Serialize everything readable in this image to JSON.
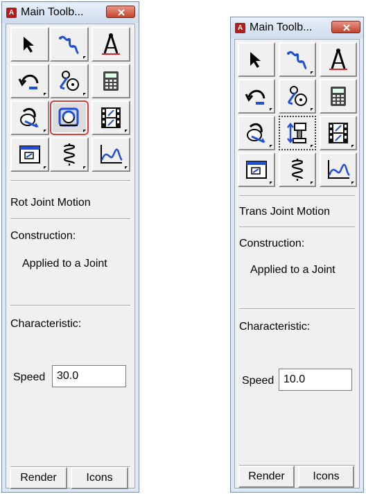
{
  "palettes": [
    {
      "title": "Main Toolb...",
      "app_icon": "A",
      "motion_label": "Rot Joint Motion",
      "construction_label": "Construction:",
      "construction_value": "Applied to a Joint",
      "characteristic_label": "Characteristic:",
      "speed_label": "Speed",
      "speed_value": "30.0",
      "render_label": "Render",
      "icons_label": "Icons",
      "selected_tool": "rot-joint-motion-icon"
    },
    {
      "title": "Main Toolb...",
      "app_icon": "A",
      "motion_label": "Trans Joint Motion",
      "construction_label": "Construction:",
      "construction_value": "Applied to a Joint",
      "characteristic_label": "Characteristic:",
      "speed_label": "Speed",
      "speed_value": "10.0",
      "render_label": "Render",
      "icons_label": "Icons",
      "selected_tool": "trans-joint-motion-icon"
    }
  ],
  "tools": [
    "select-arrow-icon",
    "spline-curve-icon",
    "measure-compass-icon",
    "undo-arc-icon",
    "connector-icon",
    "calculator-icon",
    "force-torque-icon",
    "joint-motion-icon",
    "animation-film-icon",
    "plot-window-icon",
    "spring-icon",
    "postprocessor-plot-icon"
  ],
  "colors": {
    "title_bg": "#d7e4f3",
    "close": "#c9402c",
    "selected_border": "#d93a3a",
    "icon_blue": "#1f4fd6"
  }
}
